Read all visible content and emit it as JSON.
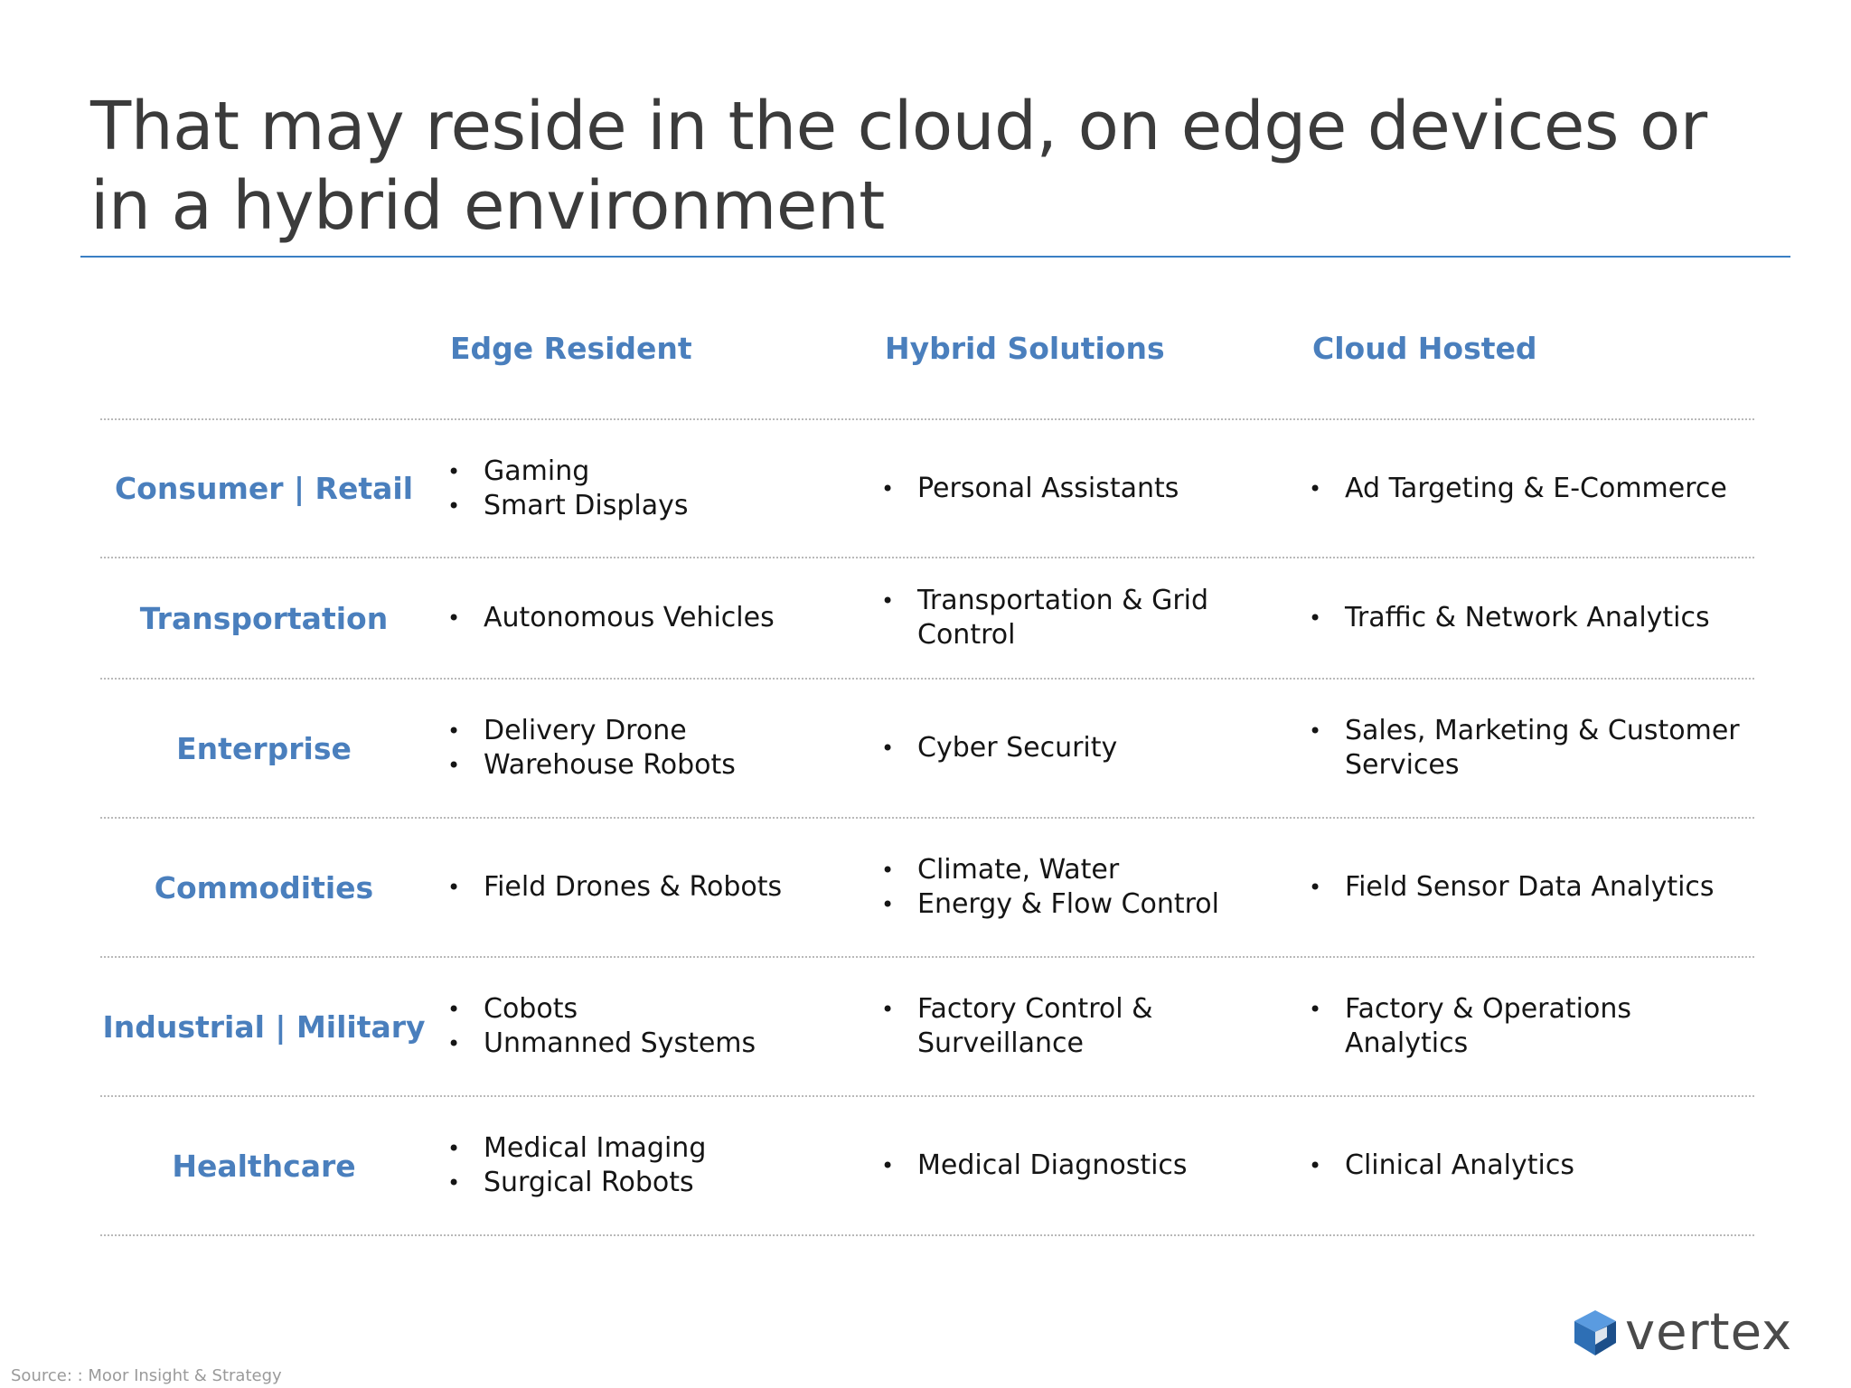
{
  "title": "That may reside in the cloud, on edge devices or in a hybrid environment",
  "columns": [
    "Edge Resident",
    "Hybrid Solutions",
    "Cloud Hosted"
  ],
  "rows": [
    {
      "label": "Consumer | Retail",
      "edge": [
        "Gaming",
        "Smart Displays"
      ],
      "hybrid": [
        "Personal Assistants"
      ],
      "cloud": [
        "Ad Targeting & E-Commerce"
      ]
    },
    {
      "label": "Transportation",
      "edge": [
        "Autonomous Vehicles"
      ],
      "hybrid": [
        "Transportation & Grid Control"
      ],
      "cloud": [
        "Traffic & Network Analytics"
      ]
    },
    {
      "label": "Enterprise",
      "edge": [
        "Delivery Drone",
        "Warehouse Robots"
      ],
      "hybrid": [
        "Cyber Security"
      ],
      "cloud": [
        "Sales, Marketing & Customer Services"
      ]
    },
    {
      "label": "Commodities",
      "edge": [
        "Field Drones & Robots"
      ],
      "hybrid": [
        "Climate, Water",
        "Energy & Flow Control"
      ],
      "cloud": [
        "Field Sensor Data Analytics"
      ]
    },
    {
      "label": "Industrial | Military",
      "edge": [
        "Cobots",
        "Unmanned Systems"
      ],
      "hybrid": [
        "Factory Control & Surveillance"
      ],
      "cloud": [
        "Factory & Operations Analytics"
      ]
    },
    {
      "label": "Healthcare",
      "edge": [
        "Medical Imaging",
        "Surgical Robots"
      ],
      "hybrid": [
        "Medical Diagnostics"
      ],
      "cloud": [
        "Clinical Analytics"
      ]
    }
  ],
  "source": "Source: : Moor Insight & Strategy",
  "logo": {
    "text": "vertex",
    "icon": "vertex-logo-icon",
    "colors": {
      "primary": "#2e6fb5",
      "dark": "#1c4f8a",
      "light": "#5a9be0"
    }
  },
  "colors": {
    "accent": "#4a7fbd",
    "title": "#3b3b3b",
    "rule": "#3a7fc4",
    "divider": "#b9b9b9"
  }
}
